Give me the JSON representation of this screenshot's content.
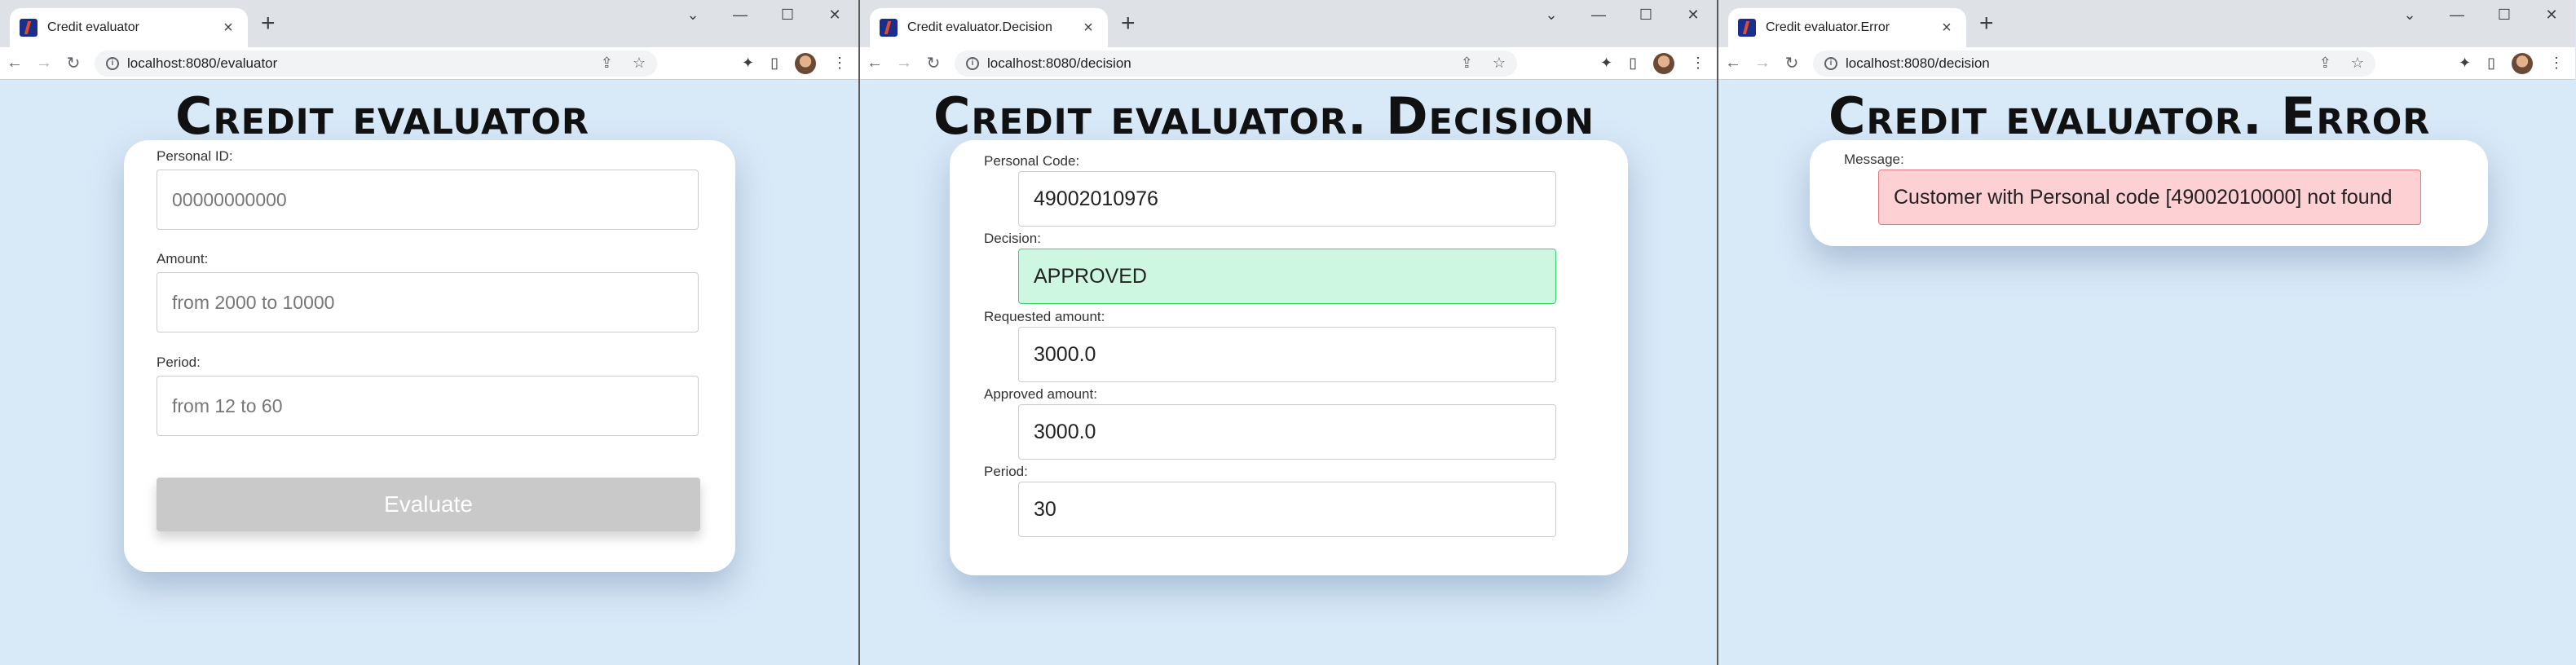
{
  "windows": [
    {
      "tab_title": "Credit evaluator",
      "url": "localhost:8080/evaluator",
      "page_title": "Credit evaluator",
      "fields": [
        {
          "label": "Personal ID:",
          "placeholder": "00000000000"
        },
        {
          "label": "Amount:",
          "placeholder": "from 2000 to 10000"
        },
        {
          "label": "Period:",
          "placeholder": "from 12 to 60"
        }
      ],
      "button_label": "Evaluate"
    },
    {
      "tab_title": "Credit evaluator.Decision",
      "url": "localhost:8080/decision",
      "page_title": "Credit evaluator. Decision",
      "fields": [
        {
          "label": "Personal Code:",
          "value": "49002010976"
        },
        {
          "label": "Decision:",
          "value": "APPROVED"
        },
        {
          "label": "Requested amount:",
          "value": "3000.0"
        },
        {
          "label": "Approved amount:",
          "value": "3000.0"
        },
        {
          "label": "Period:",
          "value": "30"
        }
      ]
    },
    {
      "tab_title": "Credit evaluator.Error",
      "url": "localhost:8080/decision",
      "page_title": "Credit evaluator. Error",
      "message_label": "Message:",
      "message": "Customer with Personal code [49002010000] not found"
    }
  ],
  "icons": [
    "browser-favicon",
    "close-icon",
    "plus-icon",
    "chevron-down-icon",
    "minimize-icon",
    "maximize-icon",
    "window-close-icon",
    "back-icon",
    "forward-icon",
    "reload-icon",
    "info-icon",
    "share-icon",
    "star-icon",
    "extensions-icon",
    "side-panel-icon",
    "avatar",
    "menu-icon"
  ],
  "colors": {
    "page_bg": "#d8e9f8",
    "approved_bg": "#cdf7e0",
    "approved_border": "#3bd16a",
    "error_bg": "#fdd0d4",
    "error_border": "#e07a80",
    "button_bg": "#c9c9c9"
  }
}
